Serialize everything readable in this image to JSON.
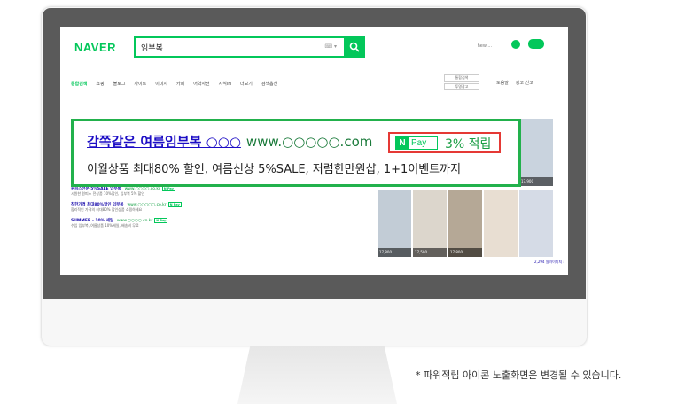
{
  "header": {
    "logo": "NAVER",
    "search_value": "임부복",
    "user": "ㅤhewl..."
  },
  "tabs": [
    "통합검색",
    "쇼핑",
    "블로그",
    "사이트",
    "이미지",
    "카페",
    "어학사전",
    "지식iN",
    "더보기",
    "검색옵션"
  ],
  "right_buttons": [
    "통합검색",
    "투명광고"
  ],
  "right_links": [
    "도움말",
    "광고 신고"
  ],
  "callout": {
    "title": "감쪽같은 여름임부복 ○○○",
    "url": "www.○○○○○.com",
    "pay_n": "N",
    "pay_word": "Pay",
    "pay_rate": "3% 적립",
    "description": "이월상품 최대80% 할인, 여름신상 5%SALE, 저렴한만원샵, 1+1이벤트까지"
  },
  "ads": [
    {
      "title": "",
      "url": "",
      "desc": "이월상품 최대80% 할인, 여름신상 5%SALE, 저렴한만원샵, 1+1이벤트까지"
    },
    {
      "title": "할인혜 주로배송 임부복쇼핑",
      "url": "www.○○○.com",
      "np": "N Pay",
      "desc": "5천원이상 무료배송 임부복 전문몰 5%할인 쿠폰지급"
    },
    {
      "title": "원피스전문 5%SALE 임부복",
      "url": "www.○○○○.co.kr",
      "np": "N Pay",
      "desc": "시원한 원피스 전상품 10%할인, 임부복 5% 할인"
    },
    {
      "title": "착한가격 최대80%할인 임부복",
      "url": "www.○○○○○.co.kr",
      "np": "N Pay",
      "desc": "합리적인 가격의 최대80% 할인상품 쇼핑하세요"
    },
    {
      "title": "SUMMER - 10% 세일",
      "url": "www.○○○○.co.kr",
      "np": "N Pay",
      "desc": "수입 임부복, 여름상품 10%세일, 배송비 무료"
    }
  ],
  "thumbs": [
    "17,800",
    "17,900",
    "19,800",
    "17,900",
    "17,900",
    "17,800",
    "17,500",
    "17,800"
  ],
  "images_more": "2,294 일러이미지 ›",
  "footnote": "* 파워적립 아이콘 노출화면은 변경될 수 있습니다.",
  "colors": {
    "naver_green": "#03c75a",
    "highlight_border": "#22b14c",
    "pay_box_border": "#e53935",
    "link_blue": "#1c0dc5"
  }
}
